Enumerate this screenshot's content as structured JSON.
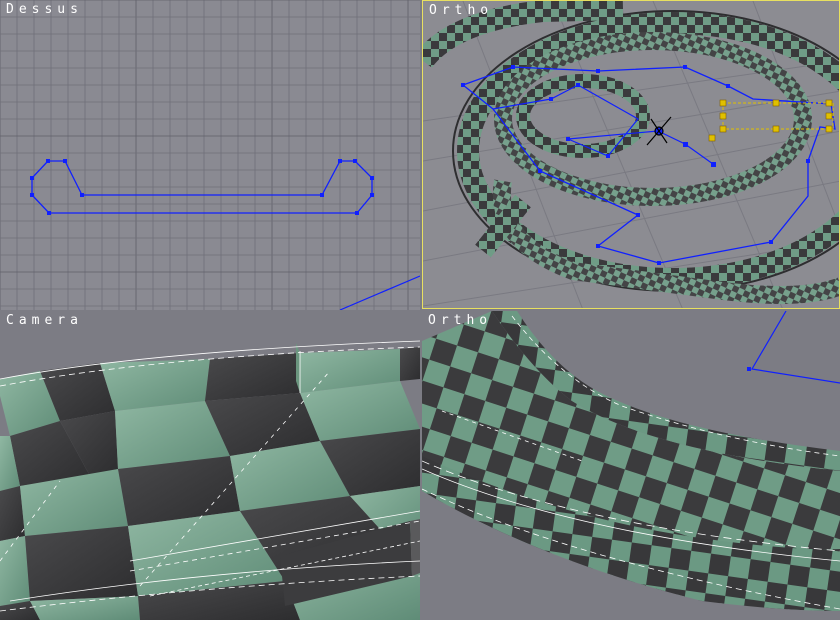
{
  "viewports": {
    "top": {
      "label": "Dessus"
    },
    "ortho1": {
      "label": "Ortho"
    },
    "camera": {
      "label": "Camera"
    },
    "ortho2": {
      "label": "Ortho"
    }
  },
  "colors": {
    "viewport_bg": "#8a8a92",
    "grid": "#6f6f78",
    "spline": "#1020ff",
    "active_border": "#e8e060",
    "selection": "#e0c000",
    "tile_green": "#6f9c86",
    "tile_dark": "#3a3a3c"
  }
}
